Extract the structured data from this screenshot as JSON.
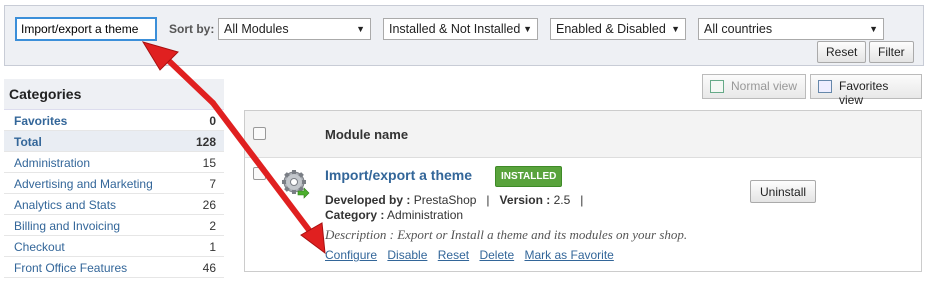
{
  "filter": {
    "search_value": "Import/export a theme",
    "sort_label": "Sort by:",
    "selects": [
      "All Modules",
      "Installed & Not Installed",
      "Enabled & Disabled",
      "All countries"
    ],
    "reset_label": "Reset",
    "filter_label": "Filter"
  },
  "views": {
    "normal": "Normal view",
    "favorites": "Favorites view"
  },
  "categories": {
    "title": "Categories",
    "items": [
      {
        "label": "Favorites",
        "count": "0"
      },
      {
        "label": "Total",
        "count": "128"
      },
      {
        "label": "Administration",
        "count": "15"
      },
      {
        "label": "Advertising and Marketing",
        "count": "7"
      },
      {
        "label": "Analytics and Stats",
        "count": "26"
      },
      {
        "label": "Billing and Invoicing",
        "count": "2"
      },
      {
        "label": "Checkout",
        "count": "1"
      },
      {
        "label": "Front Office Features",
        "count": "46"
      }
    ]
  },
  "module": {
    "header": "Module name",
    "name": "Import/export a theme",
    "badge": "INSTALLED",
    "developed_label": "Developed by :",
    "developer": "PrestaShop",
    "version_label": "Version :",
    "version": "2.5",
    "category_label": "Category :",
    "category": "Administration",
    "description": "Description : Export or Install a theme and its modules on your shop.",
    "uninstall_label": "Uninstall",
    "actions": [
      "Configure",
      "Disable",
      "Reset",
      "Delete",
      "Mark as Favorite"
    ]
  },
  "colors": {
    "accent": "#336699",
    "installed": "#59a33c",
    "arrow": "#e02020"
  }
}
